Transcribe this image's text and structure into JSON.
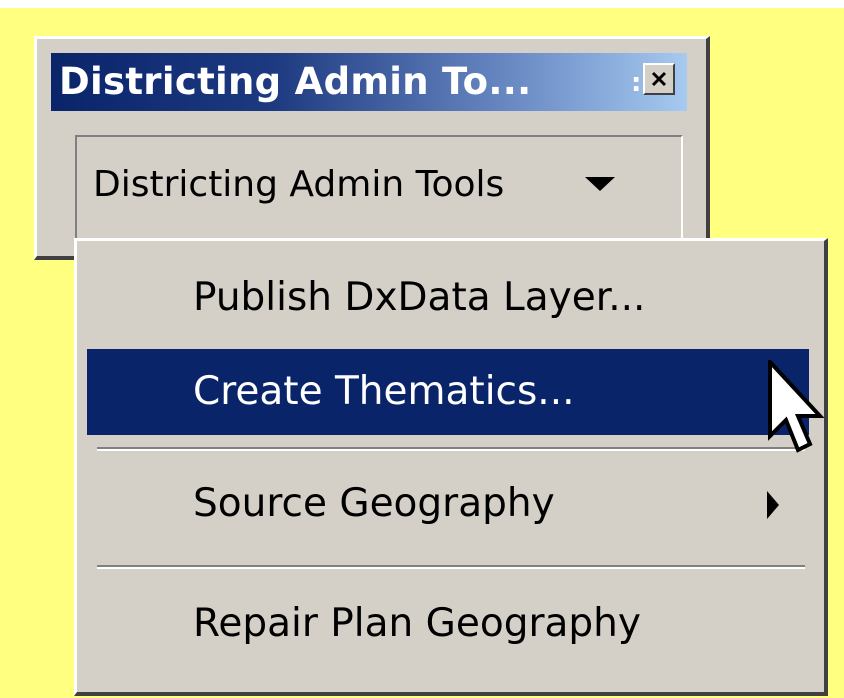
{
  "toolbar": {
    "title": "Districting Admin To...",
    "grip_char": ":",
    "close_icon": "close-x-icon",
    "dropdown_label": "Districting Admin Tools",
    "dropdown_icon": "chevron-down-icon"
  },
  "menu": {
    "items": [
      {
        "label": "Publish DxData Layer...",
        "highlighted": false,
        "submenu": false
      },
      {
        "label": "Create Thematics...",
        "highlighted": true,
        "submenu": false
      },
      {
        "label": "Source Geography",
        "highlighted": false,
        "submenu": true
      },
      {
        "label": "Repair Plan Geography",
        "highlighted": false,
        "submenu": false
      }
    ]
  },
  "colors": {
    "background": "#ffff80",
    "face": "#d4d0c8",
    "highlight": "#0a246a",
    "title_gradient_start": "#0a246a",
    "title_gradient_end": "#a6caf0"
  }
}
